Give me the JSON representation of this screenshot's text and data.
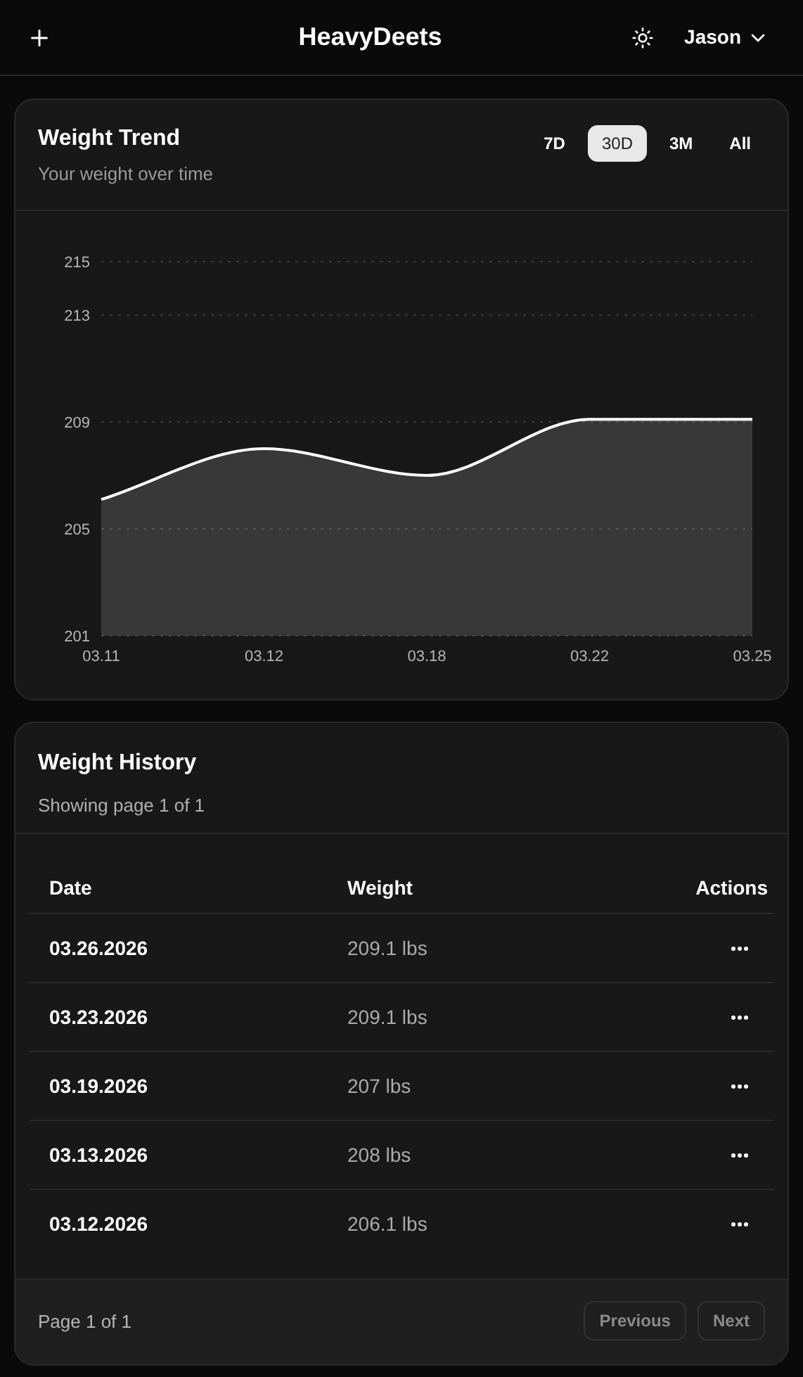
{
  "header": {
    "title": "HeavyDeets",
    "user": "Jason"
  },
  "trend": {
    "title": "Weight Trend",
    "subtitle": "Your weight over time",
    "ranges": [
      {
        "label": "7D",
        "selected": false
      },
      {
        "label": "30D",
        "selected": true
      },
      {
        "label": "3M",
        "selected": false
      },
      {
        "label": "All",
        "selected": false
      }
    ],
    "chart_data": {
      "type": "area",
      "categories": [
        "03.11",
        "03.12",
        "03.18",
        "03.22",
        "03.25"
      ],
      "series": [
        {
          "color": "#ffffff",
          "values": [
            206.1,
            208,
            207,
            209.1,
            209.1
          ]
        }
      ],
      "ylim": [
        201,
        215
      ],
      "yticks": [
        201,
        205,
        209,
        213,
        215
      ],
      "grid": true
    }
  },
  "history": {
    "title": "Weight History",
    "subtitle": "Showing page 1 of 1",
    "columns": [
      "Date",
      "Weight",
      "Actions"
    ],
    "rows": [
      {
        "date": "03.26.2026",
        "weight": "209.1 lbs"
      },
      {
        "date": "03.23.2026",
        "weight": "209.1 lbs"
      },
      {
        "date": "03.19.2026",
        "weight": "207 lbs"
      },
      {
        "date": "03.13.2026",
        "weight": "208 lbs"
      },
      {
        "date": "03.12.2026",
        "weight": "206.1 lbs"
      }
    ],
    "page_label": "Page 1 of 1",
    "buttons": [
      {
        "label": "Previous",
        "disabled": true
      },
      {
        "label": "Next",
        "disabled": true
      }
    ]
  }
}
